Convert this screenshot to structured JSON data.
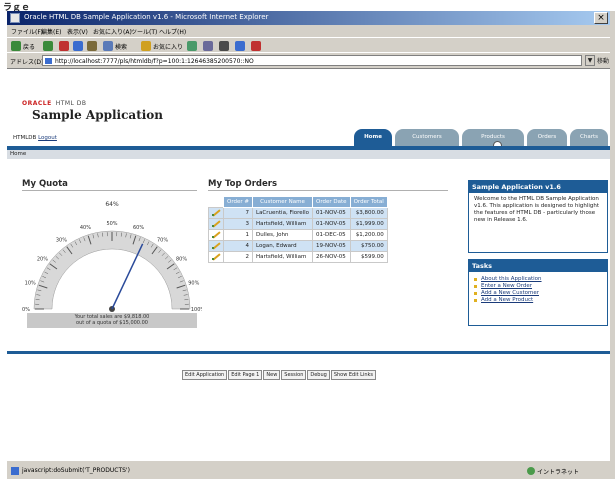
{
  "window": {
    "caption": "ラｇｅ",
    "title": "Oracle HTML DB Sample Application v1.6 - Microsoft Internet Explorer",
    "close_glyph": "×"
  },
  "browser": {
    "menu": [
      "ファイル(F)",
      "編集(E)",
      "表示(V)",
      "お気に入り(A)",
      "ツール(T)",
      "ヘルプ(H)"
    ],
    "toolbar": {
      "back": "戻る",
      "search": "検索",
      "favorites": "お気に入り"
    },
    "address_label": "アドレス(D)",
    "address_url": "http://localhost:7777/pls/htmldb/f?p=100:1:12646385200570::NO",
    "go_label": "移動"
  },
  "header": {
    "oracle_logo": "ORACLE",
    "logo_sub": "HTML DB",
    "app_title": "Sample Application",
    "user_prefix": "HTMLDB",
    "logout_label": "Logout"
  },
  "tabs": [
    {
      "label": "Home",
      "active": true
    },
    {
      "label": "Customers",
      "active": false
    },
    {
      "label": "Products",
      "active": false
    },
    {
      "label": "Orders",
      "active": false
    },
    {
      "label": "Charts",
      "active": false
    }
  ],
  "breadcrumb": "Home",
  "quote": {
    "title": "My Quota",
    "caption_line1": "Your total sales are $9,818.00",
    "caption_line2": "out of a quota of $15,000.00",
    "percent": 64,
    "scale_labels": [
      "0%",
      "10%",
      "20%",
      "30%",
      "40%",
      "50%",
      "60%",
      "70%",
      "80%",
      "90%",
      "100%"
    ],
    "value_label": "64%"
  },
  "orders": {
    "title": "My Top Orders",
    "columns": [
      "Order #",
      "Customer Name",
      "Order Date",
      "Order Total"
    ],
    "rows": [
      {
        "order": "7",
        "customer": "LaCruentia, Fiorello",
        "date": "01-NOV-05",
        "total": "$3,800.00",
        "hl": true
      },
      {
        "order": "3",
        "customer": "Hartsfield, William",
        "date": "01-NOV-05",
        "total": "$1,999.00",
        "hl": true
      },
      {
        "order": "1",
        "customer": "Dulles, John",
        "date": "01-DEC-05",
        "total": "$1,200.00",
        "hl": false
      },
      {
        "order": "4",
        "customer": "Logan, Edward",
        "date": "19-NOV-05",
        "total": "$750.00",
        "hl": true
      },
      {
        "order": "2",
        "customer": "Hartsfield, William",
        "date": "26-NOV-05",
        "total": "$599.00",
        "hl": false
      }
    ]
  },
  "info": {
    "title": "Sample Application v1.6",
    "body": "Welcome to the HTML DB Sample Application v1.6. This application is designed to highlight the features of HTML DB - particularly those new in Release 1.6."
  },
  "tasks": {
    "title": "Tasks",
    "items": [
      "About this Application",
      "Enter a New Order",
      "Add a New Customer",
      "Add a New Product"
    ]
  },
  "dev_toolbar": [
    "Edit Application",
    "Edit Page 1",
    "New",
    "Session",
    "Debug",
    "Show Edit Links"
  ],
  "status": {
    "text": "javascript:doSubmit('T_PRODUCTS')",
    "zone": "イントラネット"
  },
  "colors": {
    "oracle_blue": "#1e5c96",
    "header_cell": "#87aed4",
    "highlight_row": "#cfe2f4"
  }
}
